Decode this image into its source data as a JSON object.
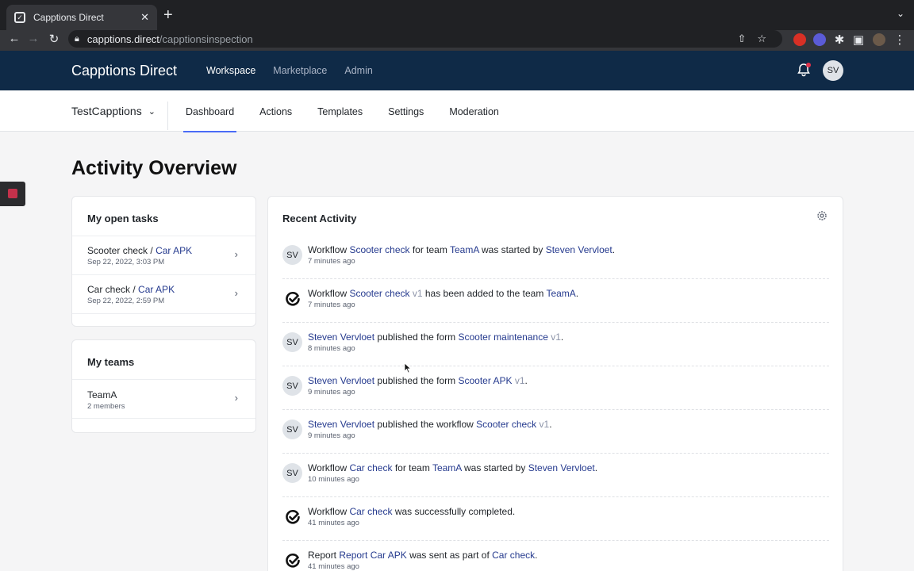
{
  "browser": {
    "tab_title": "Capptions Direct",
    "tab_close": "✕",
    "new_tab": "+",
    "url_host": "capptions.direct",
    "url_path": "/capptionsinspection"
  },
  "app": {
    "brand": "Capptions Direct",
    "nav": [
      {
        "label": "Workspace",
        "active": true
      },
      {
        "label": "Marketplace",
        "active": false
      },
      {
        "label": "Admin",
        "active": false
      }
    ],
    "user_initials": "SV",
    "colors": {
      "header_bg": "#0f2a47",
      "link": "#253a8e",
      "accent": "#4a6cf7",
      "notification_dot": "#e0314b"
    }
  },
  "subnav": {
    "team": "TestCapptions",
    "items": [
      {
        "label": "Dashboard",
        "active": true
      },
      {
        "label": "Actions",
        "active": false
      },
      {
        "label": "Templates",
        "active": false
      },
      {
        "label": "Settings",
        "active": false
      },
      {
        "label": "Moderation",
        "active": false
      }
    ]
  },
  "page": {
    "title": "Activity Overview"
  },
  "open_tasks": {
    "title": "My open tasks",
    "items": [
      {
        "workflow": "Scooter check",
        "separator": " / ",
        "form": "Car APK",
        "date": "Sep 22, 2022, 3:03 PM"
      },
      {
        "workflow": "Car check",
        "separator": " / ",
        "form": "Car APK",
        "date": "Sep 22, 2022, 2:59 PM"
      }
    ]
  },
  "teams": {
    "title": "My teams",
    "items": [
      {
        "name": "TeamA",
        "members": "2 members"
      }
    ]
  },
  "activity": {
    "title": "Recent Activity",
    "items": [
      {
        "icon": "SV",
        "parts": [
          "Workflow ",
          "Scooter check",
          " for team ",
          "TeamA",
          " was started by ",
          "Steven Vervloet",
          "."
        ],
        "version": "",
        "time": "7 minutes ago"
      },
      {
        "icon": "check",
        "parts": [
          "Workflow ",
          "Scooter check",
          " ",
          "v1",
          " has been added to the team ",
          "TeamA",
          "."
        ],
        "time": "7 minutes ago"
      },
      {
        "icon": "SV",
        "parts": [
          "Steven Vervloet",
          " published the form ",
          "Scooter maintenance",
          " ",
          "v1",
          "."
        ],
        "time": "8 minutes ago"
      },
      {
        "icon": "SV",
        "parts": [
          "Steven Vervloet",
          " published the form ",
          "Scooter APK",
          " ",
          "v1",
          "."
        ],
        "time": "9 minutes ago"
      },
      {
        "icon": "SV",
        "parts": [
          "Steven Vervloet",
          " published the workflow ",
          "Scooter check",
          " ",
          "v1",
          "."
        ],
        "time": "9 minutes ago"
      },
      {
        "icon": "SV",
        "parts": [
          "Workflow ",
          "Car check",
          " for team ",
          "TeamA",
          " was started by ",
          "Steven Vervloet",
          "."
        ],
        "time": "10 minutes ago"
      },
      {
        "icon": "check",
        "parts": [
          "Workflow ",
          "Car check",
          " was successfully completed."
        ],
        "time": "41 minutes ago"
      },
      {
        "icon": "check",
        "parts": [
          "Report ",
          "Report Car APK",
          " was sent as part of ",
          "Car check",
          "."
        ],
        "time": "41 minutes ago"
      }
    ]
  }
}
